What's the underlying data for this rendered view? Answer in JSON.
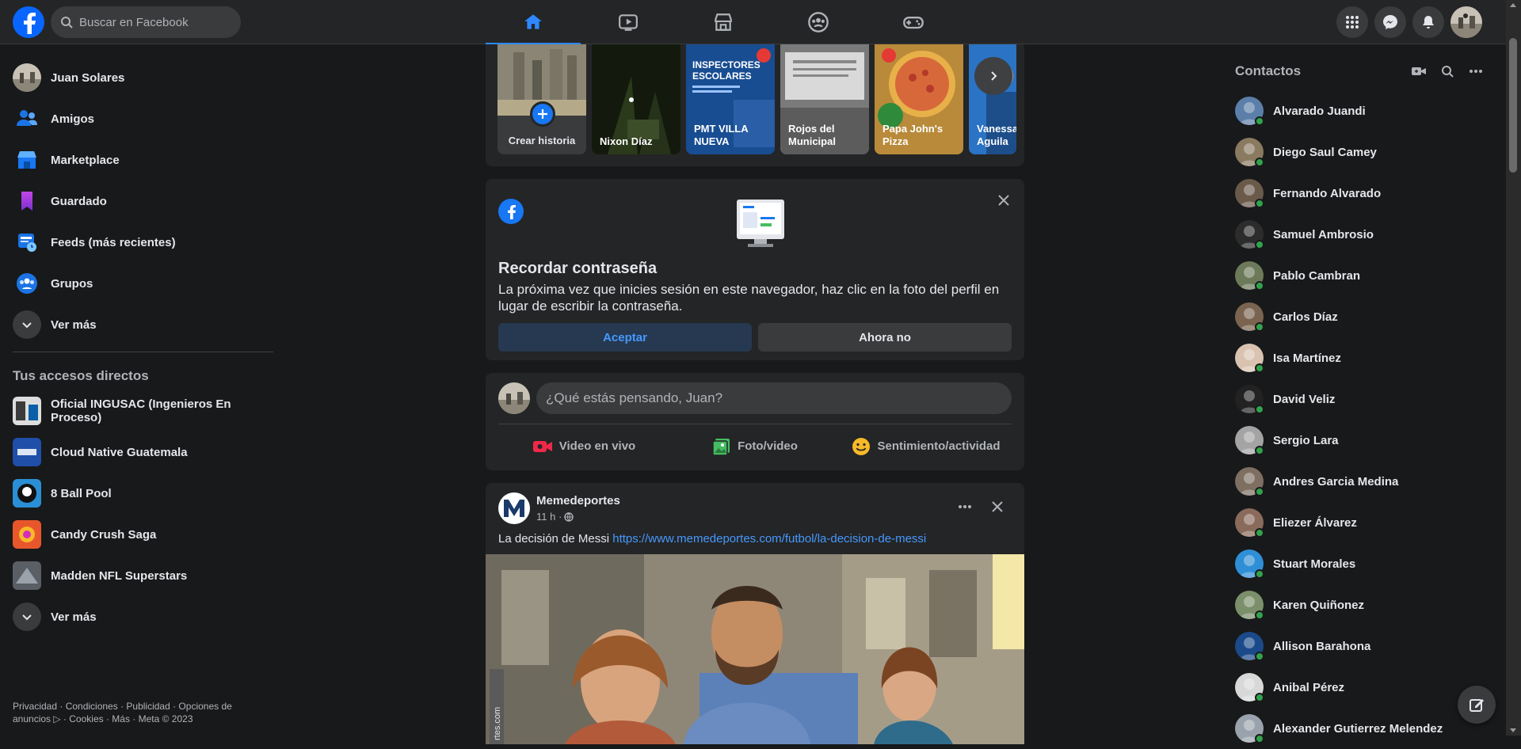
{
  "header": {
    "search_placeholder": "Buscar en Facebook",
    "nav_tabs": [
      {
        "name": "home-icon",
        "active": true
      },
      {
        "name": "watch-icon",
        "active": false
      },
      {
        "name": "marketplace-icon",
        "active": false
      },
      {
        "name": "groups-icon",
        "active": false
      },
      {
        "name": "gaming-icon",
        "active": false
      }
    ],
    "accent_color": "#2d88ff",
    "brand_color": "#0866ff"
  },
  "left_sidebar": {
    "profile_name": "Juan Solares",
    "items": [
      {
        "label": "Amigos",
        "icon": "friends-icon"
      },
      {
        "label": "Marketplace",
        "icon": "marketplace-icon"
      },
      {
        "label": "Guardado",
        "icon": "saved-icon"
      },
      {
        "label": "Feeds (más recientes)",
        "icon": "feeds-icon"
      },
      {
        "label": "Grupos",
        "icon": "groups-icon"
      }
    ],
    "see_more": "Ver más",
    "shortcuts_title": "Tus accesos directos",
    "shortcuts": [
      {
        "label": "Oficial INGUSAC (Ingenieros En Proceso)"
      },
      {
        "label": "Cloud Native Guatemala"
      },
      {
        "label": "8 Ball Pool"
      },
      {
        "label": "Candy Crush Saga"
      },
      {
        "label": "Madden NFL Superstars"
      }
    ],
    "shortcuts_see_more": "Ver más",
    "footer_line1": "Privacidad · Condiciones · Publicidad · Opciones de",
    "footer_line2": "anuncios ▷ · Cookies · Más · Meta © 2023"
  },
  "stories": {
    "create_label": "Crear historia",
    "items": [
      {
        "label": "Nixon Díaz"
      },
      {
        "label": "PMT VILLA NUEVA"
      },
      {
        "label": "Rojos del Municipal"
      },
      {
        "label": "Papa John's Pizza"
      },
      {
        "label": "Vanessa Aguila"
      }
    ],
    "story_art": {
      "inspectores_line1": "INSPECTORES",
      "inspectores_line2": "ESCOLARES"
    }
  },
  "remember_password": {
    "title": "Recordar contraseña",
    "body": "La próxima vez que inicies sesión en este navegador, haz clic en la foto del perfil en lugar de escribir la contraseña.",
    "accept_label": "Aceptar",
    "decline_label": "Ahora no"
  },
  "composer": {
    "placeholder": "¿Qué estás pensando, Juan?",
    "actions": [
      {
        "label": "Video en vivo",
        "icon": "live-video-icon",
        "color": "#f02849"
      },
      {
        "label": "Foto/video",
        "icon": "photo-video-icon",
        "color": "#45bd62"
      },
      {
        "label": "Sentimiento/actividad",
        "icon": "feeling-icon",
        "color": "#f7b928"
      }
    ]
  },
  "post": {
    "author": "Memedeportes",
    "time": "11 h ·",
    "text": "La decisión de Messi",
    "link": "https://www.memedeportes.com/futbol/la-decision-de-messi",
    "watermark": "rtes.com"
  },
  "contacts": {
    "title": "Contactos",
    "items": [
      {
        "name": "Alvarado Juandi"
      },
      {
        "name": "Diego Saul Camey"
      },
      {
        "name": "Fernando Alvarado"
      },
      {
        "name": "Samuel Ambrosio"
      },
      {
        "name": "Pablo Cambran"
      },
      {
        "name": "Carlos Díaz"
      },
      {
        "name": "Isa Martínez"
      },
      {
        "name": "David Veliz"
      },
      {
        "name": "Sergio Lara"
      },
      {
        "name": "Andres Garcia Medina"
      },
      {
        "name": "Eliezer Álvarez"
      },
      {
        "name": "Stuart Morales"
      },
      {
        "name": "Karen Quiñonez"
      },
      {
        "name": "Allison Barahona"
      },
      {
        "name": "Anibal Pérez"
      },
      {
        "name": "Alexander Gutierrez Melendez"
      }
    ]
  }
}
